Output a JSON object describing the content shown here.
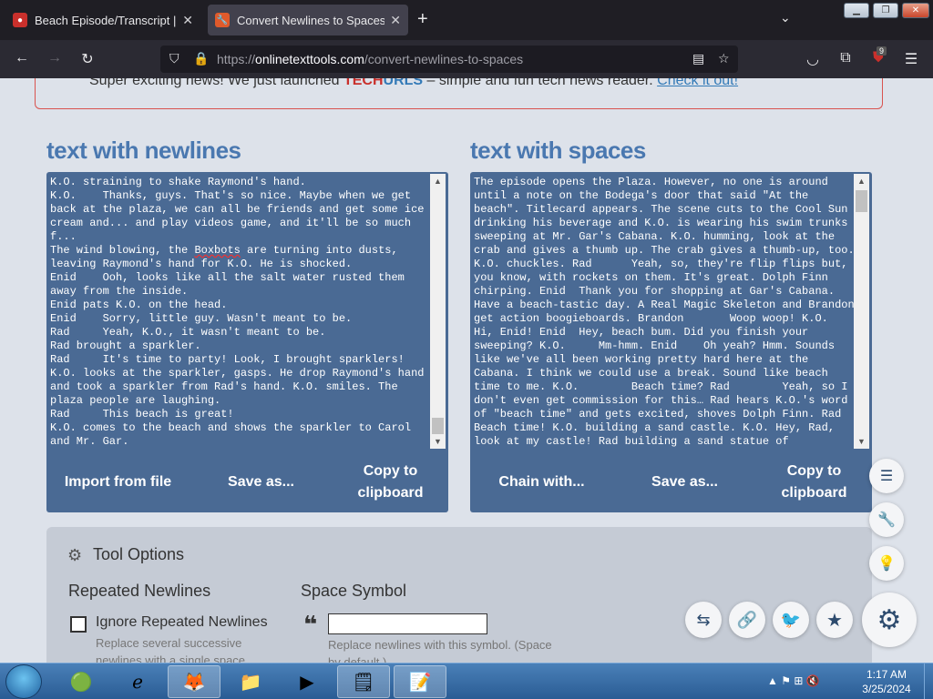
{
  "browser": {
    "tabs": [
      {
        "title": "Beach Episode/Transcript | OK K",
        "icon": "ok-ko-favicon",
        "active": false
      },
      {
        "title": "Convert Newlines to Spaces in",
        "icon": "onlinetexttools-favicon",
        "active": true
      }
    ],
    "url_prefix": "https://",
    "url_domain": "onlinetexttools.com",
    "url_path": "/convert-newlines-to-spaces",
    "extension_badge": "9"
  },
  "banner": {
    "prefix": "Super exciting news! We just launched ",
    "brand_tech": "TECH",
    "brand_urls": "URLS",
    "middle": " – simple and fun tech news reader. ",
    "link": "Check it out!"
  },
  "input_panel": {
    "title": "text with newlines",
    "text_before": "K.O. straining to shake Raymond's hand.\nK.O.    Thanks, guys. That's so nice. Maybe when we get back at the plaza, we can all be friends and get some ice cream and... and play videos game, and it'll be so much f...\nThe wind blowing, the ",
    "text_error": "Boxbots",
    "text_after": " are turning into dusts, leaving Raymond's hand for K.O. He is shocked.\nEnid    Ooh, looks like all the salt water rusted them away from the inside.\nEnid pats K.O. on the head.\nEnid    Sorry, little guy. Wasn't meant to be.\nRad     Yeah, K.O., it wasn't meant to be.\nRad brought a sparkler.\nRad     It's time to party! Look, I brought sparklers!\nK.O. looks at the sparkler, gasps. He drop Raymond's hand and took a sparkler from Rad's hand. K.O. smiles. The plaza people are laughing.\nRad     This beach is great!\nK.O. comes to the beach and shows the sparkler to Carol and Mr. Gar.",
    "buttons": [
      "Import from file",
      "Save as...",
      "Copy to clipboard"
    ]
  },
  "output_panel": {
    "title": "text with spaces",
    "text": "The episode opens the Plaza. However, no one is around until a note on the Bodega's door that said \"At the beach\". Titlecard appears. The scene cuts to the Cool Sun drinking his beverage and K.O. is wearing his swim trunks sweeping at Mr. Gar's Cabana. K.O. humming, look at the crab and gives a thumb up. The crab gives a thumb-up, too. K.O. chuckles. Rad      Yeah, so, they're flip flips but, you know, with rockets on them. It's great. Dolph Finn chirping. Enid  Thank you for shopping at Gar's Cabana. Have a beach-tastic day. A Real Magic Skeleton and Brandon get action boogieboards. Brandon       Woop woop! K.O.    Hi, Enid! Enid  Hey, beach bum. Did you finish your sweeping? K.O.     Mm-hmm. Enid    Oh yeah? Hmm. Sounds like we've all been working pretty hard here at the Cabana. I think we could use a break. Sound like beach time to me. K.O.        Beach time? Rad        Yeah, so I don't even get commission for this… Rad hears K.O.'s word of \"beach time\" and gets excited, shoves Dolph Finn. Rad     Beach time! K.O. building a sand castle. K.O. Hey, Rad, look at my castle! Rad building a sand statue of",
    "buttons": [
      "Chain with...",
      "Save as...",
      "Copy to clipboard"
    ]
  },
  "tool_options": {
    "title": "Tool Options",
    "repeated_header": "Repeated Newlines",
    "ignore_label": "Ignore Repeated Newlines",
    "ignore_desc": "Replace several successive newlines with a single space.",
    "ignore_checked": false,
    "space_header": "Space Symbol",
    "space_value": "",
    "space_desc": "Replace newlines with this symbol. (Space by default.)"
  },
  "taskbar": {
    "time": "1:17 AM",
    "date": "3/25/2024"
  },
  "colors": {
    "panel_bg": "#4a6a94",
    "title_blue": "#4a78b0",
    "banner_border": "#d9534f"
  }
}
